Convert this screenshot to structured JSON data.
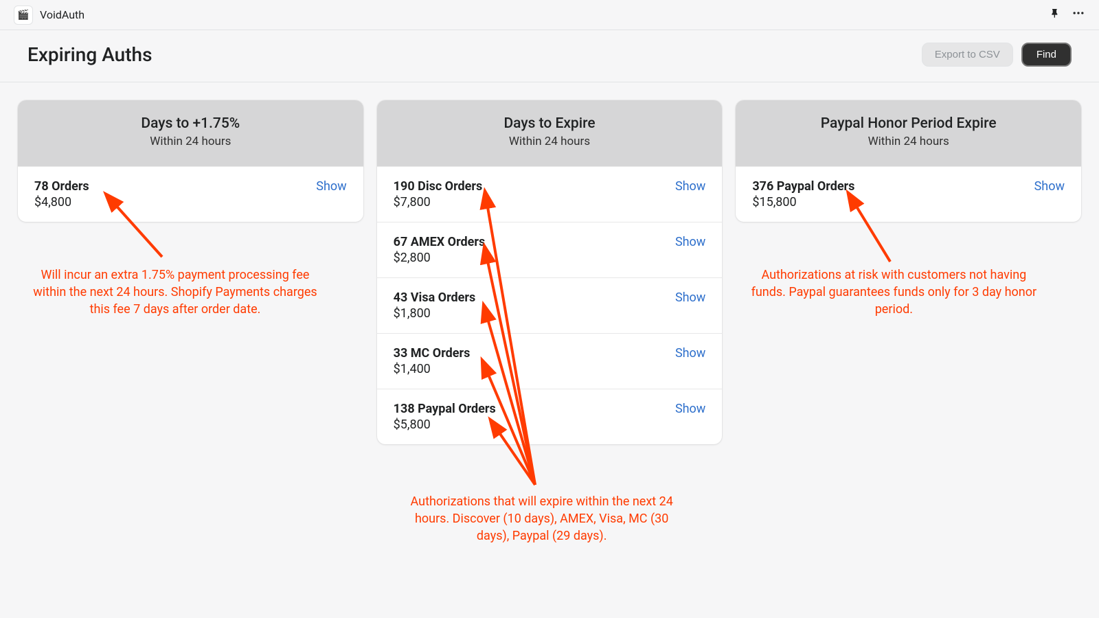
{
  "topbar": {
    "app_name": "VoidAuth",
    "app_icon": "🎬"
  },
  "header": {
    "title": "Expiring Auths",
    "export_label": "Export to CSV",
    "find_label": "Find"
  },
  "cards": {
    "c1": {
      "title": "Days to +1.75%",
      "subtitle": "Within 24 hours",
      "rows": [
        {
          "title": "78 Orders",
          "amount": "$4,800",
          "action": "Show"
        }
      ]
    },
    "c2": {
      "title": "Days to Expire",
      "subtitle": "Within 24 hours",
      "rows": [
        {
          "title": "190 Disc Orders",
          "amount": "$7,800",
          "action": "Show"
        },
        {
          "title": "67 AMEX Orders",
          "amount": "$2,800",
          "action": "Show"
        },
        {
          "title": "43 Visa Orders",
          "amount": "$1,800",
          "action": "Show"
        },
        {
          "title": "33 MC Orders",
          "amount": "$1,400",
          "action": "Show"
        },
        {
          "title": "138 Paypal Orders",
          "amount": "$5,800",
          "action": "Show"
        }
      ]
    },
    "c3": {
      "title": "Paypal Honor Period Expire",
      "subtitle": "Within 24 hours",
      "rows": [
        {
          "title": "376 Paypal Orders",
          "amount": "$15,800",
          "action": "Show"
        }
      ]
    }
  },
  "annotations": {
    "a1": "Will incur an extra 1.75% payment processing fee within the next 24 hours.  Shopify Payments charges this fee 7 days after order date.",
    "a2": "Authorizations that will expire within the next 24 hours.  Discover (10 days), AMEX, Visa, MC (30 days), Paypal (29 days).",
    "a3": "Authorizations at risk with customers not having funds.  Paypal guarantees funds only for 3 day honor period."
  }
}
